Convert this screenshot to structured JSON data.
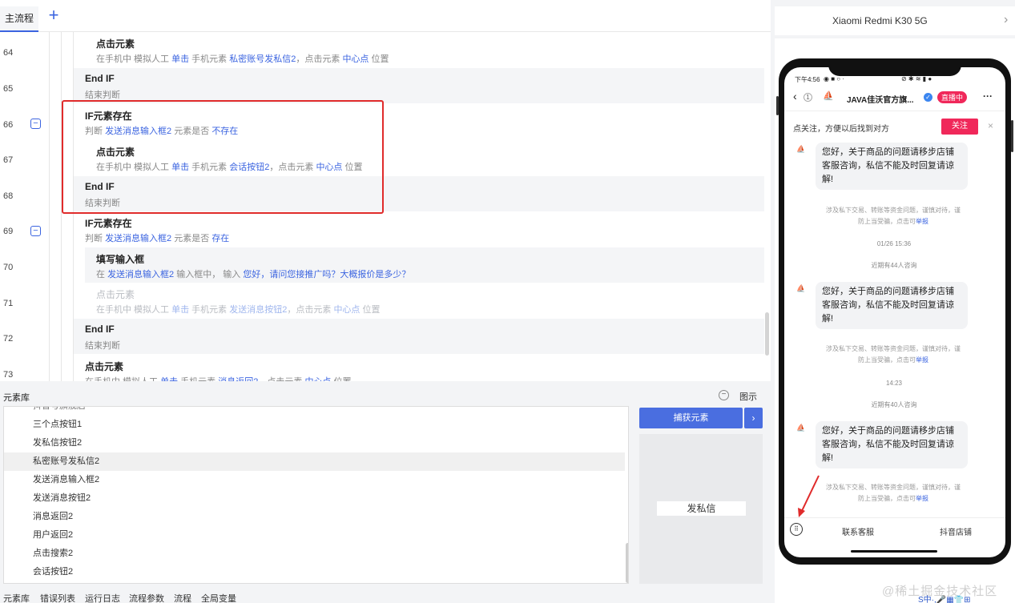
{
  "tabs": {
    "main": "主流程",
    "add": "+"
  },
  "flow": {
    "line_numbers": [
      "64",
      "65",
      "66",
      "67",
      "68",
      "69",
      "70",
      "71",
      "72",
      "73"
    ],
    "collapse_symbol": "−",
    "blocks": [
      {
        "title": "点击元素",
        "desc": [
          {
            "t": "在手机中 模拟人工 "
          },
          {
            "t": "单击",
            "h": true
          },
          {
            "t": " 手机元素 "
          },
          {
            "t": "私密账号发私信2",
            "h": true
          },
          {
            "t": "，点击元素 "
          },
          {
            "t": "中心点",
            "h": true
          },
          {
            "t": " 位置"
          }
        ]
      },
      {
        "title": "End IF",
        "desc": [
          {
            "t": "结束判断"
          }
        ]
      },
      {
        "title": "IF元素存在",
        "desc": [
          {
            "t": "判断 "
          },
          {
            "t": "发送消息输入框2",
            "h": true
          },
          {
            "t": " 元素是否 "
          },
          {
            "t": "不存在",
            "h": true
          }
        ]
      },
      {
        "title": "点击元素",
        "desc": [
          {
            "t": "在手机中 模拟人工 "
          },
          {
            "t": "单击",
            "h": true
          },
          {
            "t": " 手机元素 "
          },
          {
            "t": "会话按钮2",
            "h": true
          },
          {
            "t": "，点击元素 "
          },
          {
            "t": "中心点",
            "h": true
          },
          {
            "t": " 位置"
          }
        ]
      },
      {
        "title": "End IF",
        "desc": [
          {
            "t": "结束判断"
          }
        ]
      },
      {
        "title": "IF元素存在",
        "desc": [
          {
            "t": "判断 "
          },
          {
            "t": "发送消息输入框2",
            "h": true
          },
          {
            "t": " 元素是否 "
          },
          {
            "t": "存在",
            "h": true
          }
        ]
      },
      {
        "title": "填写输入框",
        "desc": [
          {
            "t": "在 "
          },
          {
            "t": "发送消息输入框2",
            "h": true
          },
          {
            "t": " 输入框中， 输入 "
          },
          {
            "t": "您好，请问您接推广吗？大概报价是多少？",
            "h": true
          }
        ]
      },
      {
        "title": "点击元素",
        "desc": [
          {
            "t": "在手机中 模拟人工 "
          },
          {
            "t": "单击",
            "h": true
          },
          {
            "t": " 手机元素 "
          },
          {
            "t": "发送消息按钮2",
            "h": true
          },
          {
            "t": "，点击元素 "
          },
          {
            "t": "中心点",
            "h": true
          },
          {
            "t": " 位置"
          }
        ]
      },
      {
        "title": "End IF",
        "desc": [
          {
            "t": "结束判断"
          }
        ]
      },
      {
        "title": "点击元素",
        "desc": [
          {
            "t": "在手机中 模拟人工 "
          },
          {
            "t": "单击",
            "h": true
          },
          {
            "t": " 手机元素 "
          },
          {
            "t": "消息返回2",
            "h": true
          },
          {
            "t": "，点击元素 "
          },
          {
            "t": "中心点",
            "h": true
          },
          {
            "t": " 位置"
          }
        ]
      }
    ]
  },
  "element_library": {
    "title": "元素库",
    "show_label": "图示",
    "collapse_symbol": "−",
    "items": [
      "抖音号旗舰店",
      "三个点按钮1",
      "发私信按钮2",
      "私密账号发私信2",
      "发送消息输入框2",
      "发送消息按钮2",
      "消息返回2",
      "用户返回2",
      "点击搜索2",
      "会话按钮2"
    ],
    "selected_index": 3,
    "capture_button": "捕获元素",
    "capture_arrow": "›",
    "preview_label": "发私信"
  },
  "bottom_tabs": [
    "元素库",
    "错误列表",
    "运行日志",
    "流程参数",
    "流程",
    "全局变量"
  ],
  "device": {
    "name": "Xiaomi Redmi K30 5G",
    "chevron": "›",
    "status_time": "下午4:56",
    "status_icons_left": "◉ ■ ○ ·",
    "status_icons_right": "⊘ ✱ ≋ ▮ ●",
    "back": "‹",
    "unread": "1",
    "shop_logo": "⛵",
    "shop_name": "JAVA佳沃官方旗...",
    "verify": "✓",
    "live_badge": "直播中",
    "more": "···",
    "follow_tip": "点关注，方便以后找到对方",
    "follow_button": "关注",
    "close": "×",
    "avatar": "⛵",
    "bubble_text": "您好，关于商品的问题请移步店铺客服咨询，私信不能及时回复请谅解!",
    "notice_text": "涉及私下交易、转账等资金问题，谨慎对待，谨防上当受骗，点击可",
    "report": "举报",
    "time1": "01/26 15:36",
    "consult1": "近期有44人咨询",
    "time2": "14:23",
    "consult2": "近期有40人咨询",
    "keyboard_icon": "⠿",
    "link1": "联系客服",
    "link2": "抖音店铺"
  },
  "watermark": "@稀土掘金技术社区",
  "ime": "S中·,🎤▦👕⊞"
}
